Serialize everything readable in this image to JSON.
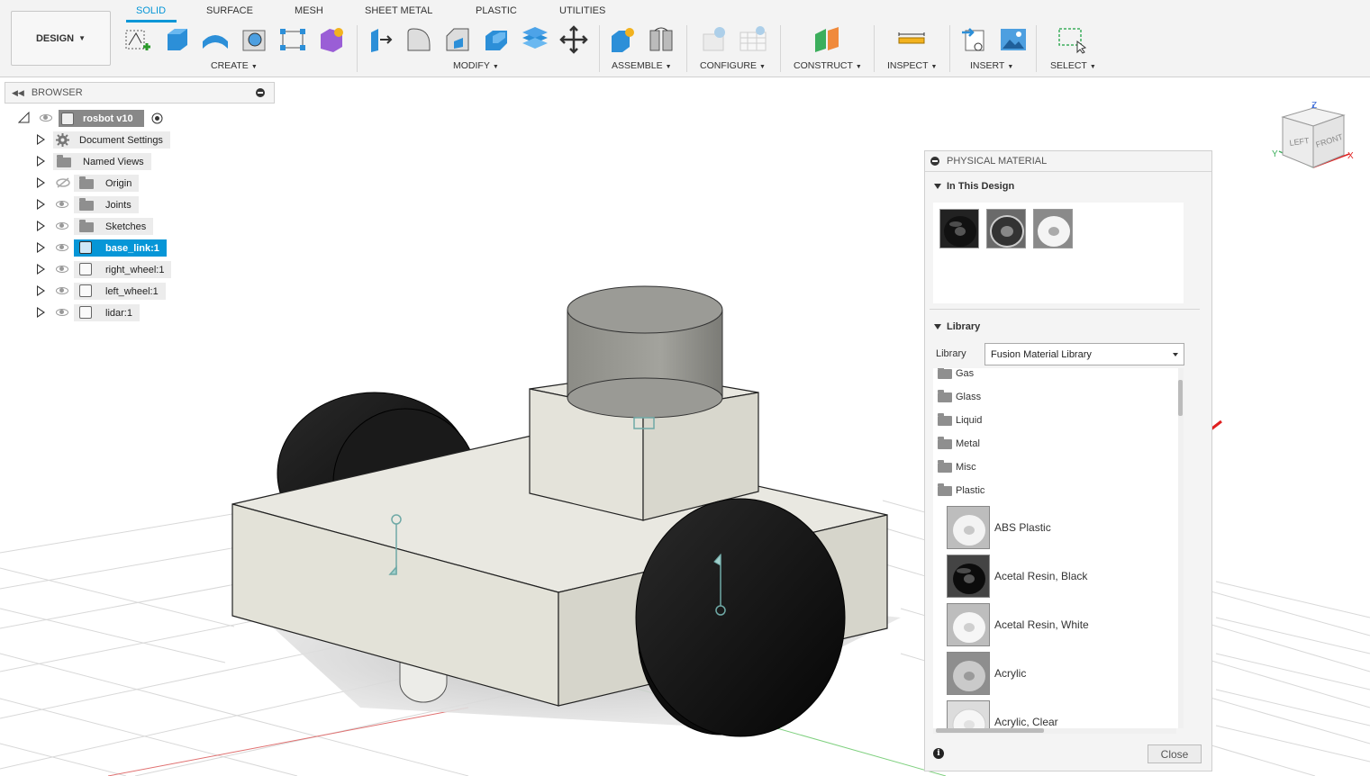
{
  "toolbar": {
    "workspace": "DESIGN",
    "tabs": [
      "SOLID",
      "SURFACE",
      "MESH",
      "SHEET METAL",
      "PLASTIC",
      "UTILITIES"
    ],
    "active_tab": "SOLID",
    "groups": [
      "CREATE",
      "MODIFY",
      "ASSEMBLE",
      "CONFIGURE",
      "CONSTRUCT",
      "INSPECT",
      "INSERT",
      "SELECT"
    ]
  },
  "browser": {
    "title": "BROWSER",
    "root": "rosbot v10",
    "items": [
      {
        "label": "Document Settings",
        "icon": "gear-icon"
      },
      {
        "label": "Named Views",
        "icon": "folder-icon"
      },
      {
        "label": "Origin",
        "icon": "folder-icon",
        "hidden": true
      },
      {
        "label": "Joints",
        "icon": "folder-icon"
      },
      {
        "label": "Sketches",
        "icon": "folder-icon"
      },
      {
        "label": "base_link:1",
        "icon": "component-icon",
        "selected": true
      },
      {
        "label": "right_wheel:1",
        "icon": "body-icon"
      },
      {
        "label": "left_wheel:1",
        "icon": "body-icon"
      },
      {
        "label": "lidar:1",
        "icon": "body-icon"
      }
    ]
  },
  "viewcube": {
    "top": "Z",
    "left": "LEFT",
    "front": "FRONT",
    "x": "X",
    "y": "Y"
  },
  "physical_material": {
    "title": "PHYSICAL MATERIAL",
    "in_design_title": "In This Design",
    "library_title": "Library",
    "library_label": "Library",
    "library_value": "Fusion Material Library",
    "folders": [
      "Gas",
      "Glass",
      "Liquid",
      "Metal",
      "Misc",
      "Plastic"
    ],
    "materials": [
      "ABS Plastic",
      "Acetal Resin, Black",
      "Acetal Resin, White",
      "Acrylic",
      "Acrylic, Clear"
    ],
    "close_label": "Close",
    "info_label": "i"
  },
  "colors": {
    "accent": "#0696d7",
    "annotation_arrow": "#e02020"
  }
}
